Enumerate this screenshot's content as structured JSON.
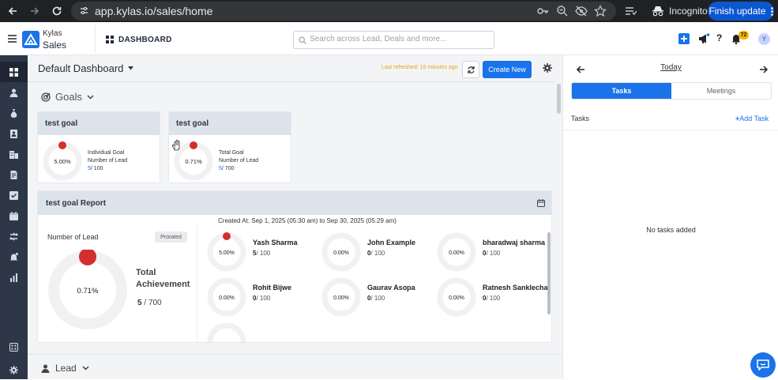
{
  "browser": {
    "url": "app.kylas.io/sales/home",
    "incognito_label": "Incognito",
    "finish_update_label": "Finish update"
  },
  "header": {
    "brand_title": "Kylas",
    "brand_subtitle": "Sales",
    "section_label": "DASHBOARD",
    "search_placeholder": "Search across Lead, Deals and more...",
    "notification_count": "72",
    "avatar_initial": "Y"
  },
  "sidebar": {
    "items": [
      "dashboard",
      "contacts",
      "deals",
      "leads",
      "companies",
      "documents",
      "tasks",
      "calendar",
      "workflows",
      "campaigns",
      "reports",
      "apps",
      "settings"
    ]
  },
  "dashboard": {
    "title": "Default Dashboard",
    "last_refreshed": "Last refreshed: 19 minutes ago",
    "create_new_label": "Create New",
    "goals_section_label": "Goals",
    "lead_section_label": "Lead"
  },
  "goal_cards": [
    {
      "title": "test goal",
      "percent": "5.00%",
      "percent_value": 5.0,
      "goal_type": "Individual Goal",
      "metric": "Number of Lead",
      "achieved": "5",
      "target": "/ 100"
    },
    {
      "title": "test goal",
      "percent": "0.71%",
      "percent_value": 0.71,
      "goal_type": "Total Goal",
      "metric": "Number of Lead",
      "achieved": "5",
      "target": "/ 700"
    }
  ],
  "report": {
    "title": "test goal Report",
    "created_at": "Created At: Sep 1, 2025 (05:30 am) to Sep 30, 2025 (05:29 am)",
    "metric_label": "Number of Lead",
    "prorated_label": "Prorated",
    "total_percent": "0.71%",
    "total_percent_value": 0.71,
    "total_achievement_label": "Total Achievement",
    "total_achieved": "5",
    "total_target": "/ 700",
    "users": [
      {
        "name": "Yash Sharma",
        "percent": "5.00%",
        "achieved": "5",
        "target": "/ 100"
      },
      {
        "name": "John Example",
        "percent": "0.00%",
        "achieved": "0",
        "target": "/ 100"
      },
      {
        "name": "bharadwaj sharma",
        "percent": "0.00%",
        "achieved": "0",
        "target": "/ 100"
      },
      {
        "name": "Rohit Bijwe",
        "percent": "0.00%",
        "achieved": "0",
        "target": "/ 100"
      },
      {
        "name": "Gaurav Asopa",
        "percent": "0.00%",
        "achieved": "0",
        "target": "/ 100"
      },
      {
        "name": "Ratnesh Sanklecha",
        "percent": "0.00%",
        "achieved": "0",
        "target": "/ 100"
      }
    ]
  },
  "right_panel": {
    "date_label": "Today",
    "tabs": [
      "Tasks",
      "Meetings"
    ],
    "tasks_label": "Tasks",
    "add_task_label": "Add Task",
    "empty_label": "No tasks added"
  },
  "colors": {
    "primary": "#1a73e8",
    "sidebar": "#2d3748",
    "progress_red": "#d32f2f",
    "warning": "#e8a317"
  }
}
